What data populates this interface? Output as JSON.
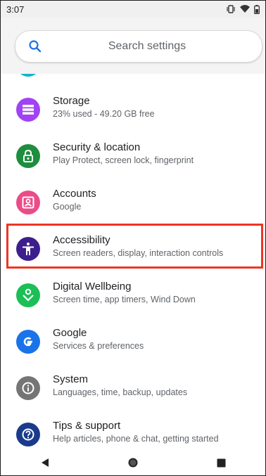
{
  "status": {
    "time": "3:07"
  },
  "search": {
    "placeholder": "Search settings"
  },
  "items": [
    {
      "title": "Storage",
      "subtitle": "23% used - 49.20 GB free",
      "color": "#a142f4"
    },
    {
      "title": "Security & location",
      "subtitle": "Play Protect, screen lock, fingerprint",
      "color": "#1e8e3e"
    },
    {
      "title": "Accounts",
      "subtitle": "Google",
      "color": "#ea4c89"
    },
    {
      "title": "Accessibility",
      "subtitle": "Screen readers, display, interaction controls",
      "color": "#3c1f8c"
    },
    {
      "title": "Digital Wellbeing",
      "subtitle": "Screen time, app timers, Wind Down",
      "color": "#1bbf55"
    },
    {
      "title": "Google",
      "subtitle": "Services & preferences",
      "color": "#1a73e8"
    },
    {
      "title": "System",
      "subtitle": "Languages, time, backup, updates",
      "color": "#757575"
    },
    {
      "title": "Tips & support",
      "subtitle": "Help articles, phone & chat, getting started",
      "color": "#1a3a8c"
    }
  ],
  "highlight_color": "#ee3524"
}
